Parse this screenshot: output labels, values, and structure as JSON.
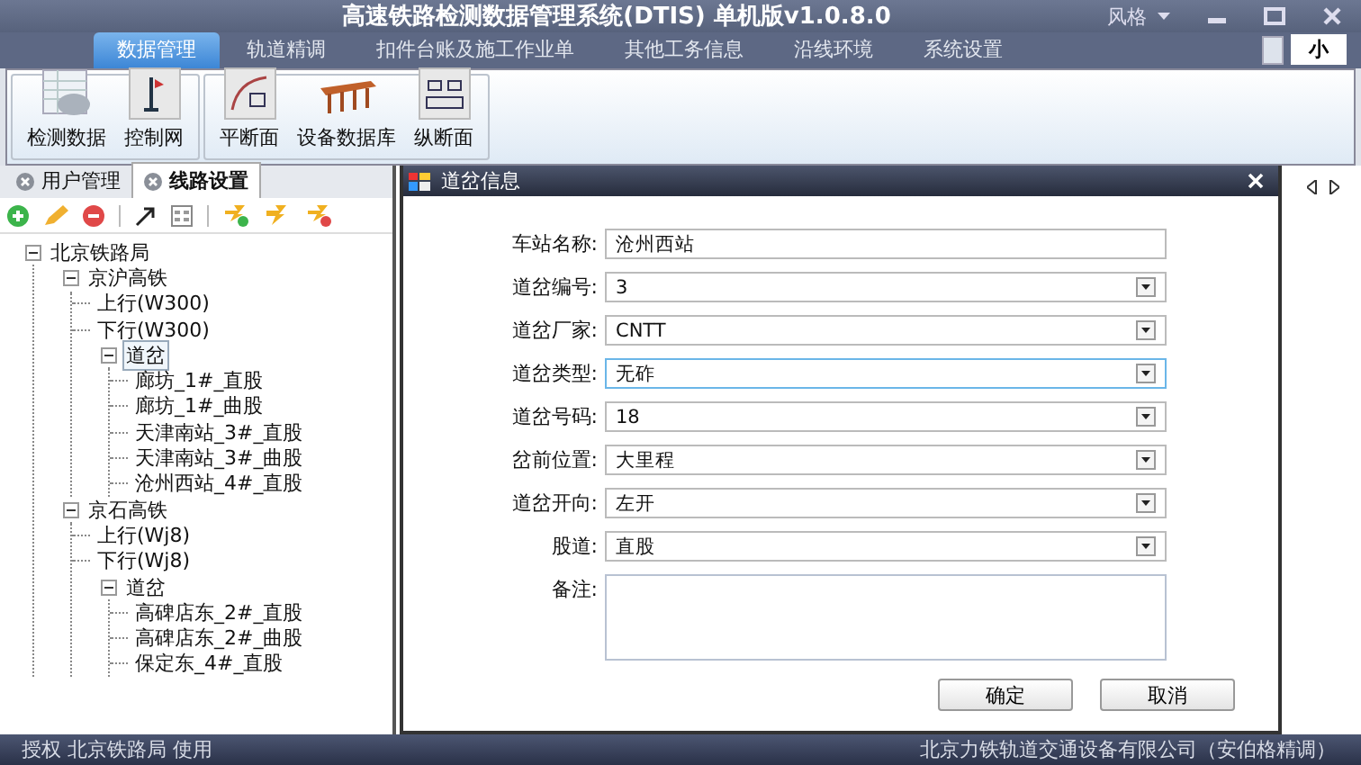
{
  "window": {
    "title": "高速铁路检测数据管理系统(DTIS) 单机版v1.0.8.0",
    "style_menu": "风格",
    "size_button": "小"
  },
  "menu_tabs": [
    {
      "label": "数据管理",
      "selected": true
    },
    {
      "label": "轨道精调",
      "selected": false
    },
    {
      "label": "扣件台账及施工作业单",
      "selected": false
    },
    {
      "label": "其他工务信息",
      "selected": false
    },
    {
      "label": "沿线环境",
      "selected": false
    },
    {
      "label": "系统设置",
      "selected": false
    }
  ],
  "ribbon": {
    "groups": [
      {
        "buttons": [
          {
            "label": "检测数据",
            "kind": "table"
          },
          {
            "label": "控制网",
            "kind": "pole"
          }
        ]
      },
      {
        "buttons": [
          {
            "label": "平断面",
            "kind": "curve"
          },
          {
            "label": "设备数据库",
            "kind": "bridge"
          },
          {
            "label": "纵断面",
            "kind": "profile"
          }
        ]
      }
    ]
  },
  "side_tabs": [
    {
      "label": "用户管理",
      "selected": false
    },
    {
      "label": "线路设置",
      "selected": true
    }
  ],
  "tree": [
    {
      "label": "北京铁路局",
      "expanded": true,
      "selected": false,
      "children": [
        {
          "label": "京沪高铁",
          "expanded": true,
          "selected": false,
          "children": [
            {
              "label": "上行(W300)",
              "selected": false
            },
            {
              "label": "下行(W300)",
              "selected": false
            },
            {
              "label": "道岔",
              "expanded": true,
              "selected": true,
              "children": [
                {
                  "label": "廊坊_1#_直股",
                  "selected": false
                },
                {
                  "label": "廊坊_1#_曲股",
                  "selected": false
                },
                {
                  "label": "天津南站_3#_直股",
                  "selected": false
                },
                {
                  "label": "天津南站_3#_曲股",
                  "selected": false
                },
                {
                  "label": "沧州西站_4#_直股",
                  "selected": false
                }
              ]
            }
          ]
        },
        {
          "label": "京石高铁",
          "expanded": true,
          "selected": false,
          "children": [
            {
              "label": "上行(Wj8)",
              "selected": false
            },
            {
              "label": "下行(Wj8)",
              "selected": false
            },
            {
              "label": "道岔",
              "expanded": true,
              "selected": false,
              "children": [
                {
                  "label": "高碑店东_2#_直股",
                  "selected": false
                },
                {
                  "label": "高碑店东_2#_曲股",
                  "selected": false
                },
                {
                  "label": "保定东_4#_直股",
                  "selected": false
                }
              ]
            }
          ]
        }
      ]
    }
  ],
  "dialog": {
    "title": "道岔信息",
    "fields": [
      {
        "label": "车站名称:",
        "kind": "text",
        "value": "沧州西站",
        "focused": false
      },
      {
        "label": "道岔编号:",
        "kind": "select",
        "value": "3",
        "focused": false
      },
      {
        "label": "道岔厂家:",
        "kind": "select",
        "value": "CNTT",
        "focused": false
      },
      {
        "label": "道岔类型:",
        "kind": "select",
        "value": "无砟",
        "focused": true
      },
      {
        "label": "道岔号码:",
        "kind": "select",
        "value": "18",
        "focused": false
      },
      {
        "label": "岔前位置:",
        "kind": "select",
        "value": "大里程",
        "focused": false
      },
      {
        "label": "道岔开向:",
        "kind": "select",
        "value": "左开",
        "focused": false
      },
      {
        "label": "股道:",
        "kind": "select",
        "value": "直股",
        "focused": false
      },
      {
        "label": "备注:",
        "kind": "textarea",
        "focused": false
      }
    ],
    "buttons": [
      "确定",
      "取消"
    ]
  },
  "status_bar": {
    "left": "授权 北京铁路局 使用",
    "right": "北京力铁轨道交通设备有限公司（安伯格精调）"
  }
}
